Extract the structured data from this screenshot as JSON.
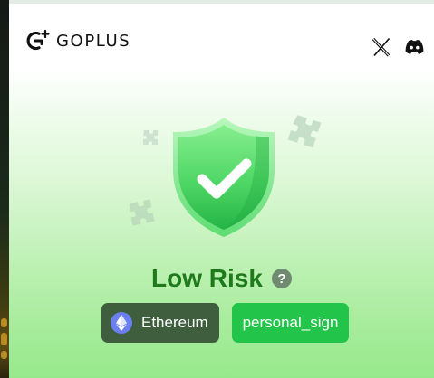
{
  "header": {
    "brand_name": "GOPLUS",
    "brand_icon": "goplus-logo-icon",
    "social_links": [
      {
        "name": "x",
        "icon": "x-icon"
      },
      {
        "name": "discord",
        "icon": "discord-icon"
      }
    ]
  },
  "risk": {
    "level": "Low Risk",
    "help_label": "?",
    "status_icon": "shield-check-icon",
    "color": "#1f7a1c"
  },
  "badges": {
    "chain": {
      "label": "Ethereum",
      "icon": "ethereum-icon"
    },
    "method": {
      "label": "personal_sign"
    }
  },
  "colors": {
    "accent_green": "#22c44a",
    "chain_badge": "#3e5e3e",
    "shield": "#3fcf58"
  }
}
